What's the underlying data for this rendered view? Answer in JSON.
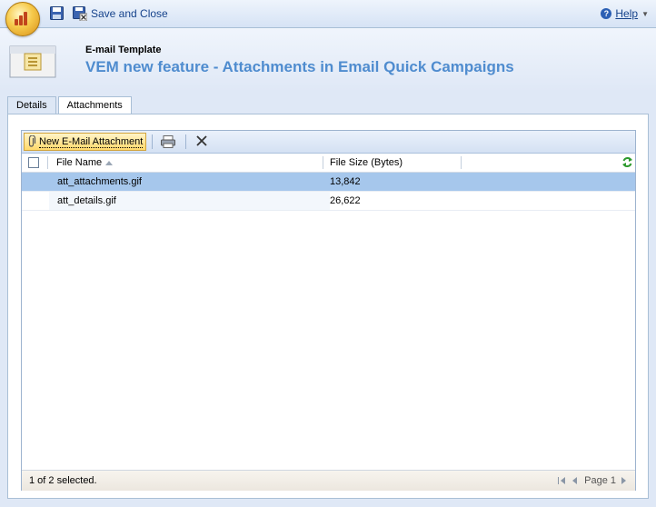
{
  "toolbar": {
    "save_close_label": "Save and Close",
    "help_label": "Help",
    "icons": [
      "app-orb-icon",
      "save-icon",
      "save-close-icon",
      "help-icon"
    ]
  },
  "header": {
    "entity_type": "E-mail Template",
    "title": "VEM new feature - Attachments in Email Quick Campaigns"
  },
  "tabs": [
    {
      "label": "Details",
      "active": false
    },
    {
      "label": "Attachments",
      "active": true
    }
  ],
  "grid": {
    "toolbar": {
      "new_attachment_label": "New E-Mail Attachment"
    },
    "columns": [
      {
        "label": "File Name",
        "sorted": "ascending"
      },
      {
        "label": "File Size (Bytes)"
      }
    ],
    "rows": [
      {
        "file_name": "att_attachments.gif",
        "file_size": "13,842",
        "selected": true
      },
      {
        "file_name": "att_details.gif",
        "file_size": "26,622",
        "selected": false
      }
    ],
    "footer": {
      "status": "1 of 2 selected.",
      "page_label": "Page 1"
    }
  },
  "colors": {
    "title": "#4f8ccf",
    "selected_row": "#a6c7ec",
    "link": "#15428b"
  }
}
